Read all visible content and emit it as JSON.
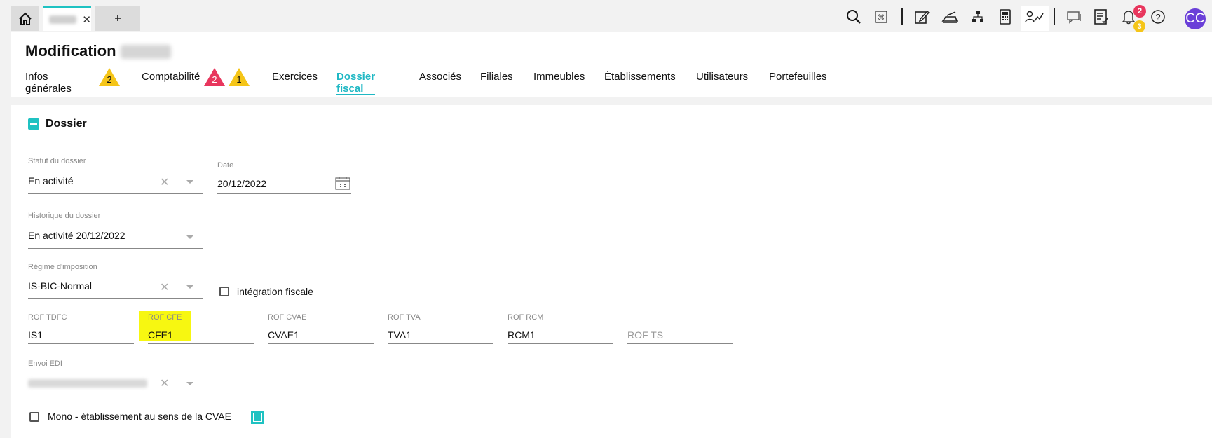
{
  "topbar": {
    "new_tab_label": "+",
    "notification_badges": [
      "2",
      "3"
    ],
    "avatar_initials": "CC",
    "icons": [
      "home-icon",
      "close-icon",
      "search-icon",
      "keyboard-icon",
      "edit-icon",
      "scanner-icon",
      "hierarchy-icon",
      "calculator-icon",
      "users-chart-icon",
      "chat-icon",
      "checklist-icon",
      "bell-icon",
      "help-icon"
    ]
  },
  "header": {
    "title": "Modification",
    "tabs": [
      {
        "label": "Infos générales",
        "badges": [
          {
            "type": "warning",
            "count": "2"
          }
        ]
      },
      {
        "label": "Comptabilité",
        "badges": [
          {
            "type": "error",
            "count": "2"
          },
          {
            "type": "warning",
            "count": "1"
          }
        ]
      },
      {
        "label": "Exercices"
      },
      {
        "label": "Dossier fiscal",
        "active": true
      },
      {
        "label": "Associés"
      },
      {
        "label": "Filiales"
      },
      {
        "label": "Immeubles"
      },
      {
        "label": "Établissements"
      },
      {
        "label": "Utilisateurs"
      },
      {
        "label": "Portefeuilles"
      }
    ]
  },
  "section": {
    "title": "Dossier",
    "statut": {
      "label": "Statut du dossier",
      "value": "En activité"
    },
    "date": {
      "label": "Date",
      "value": "20/12/2022"
    },
    "historique": {
      "label": "Historique du dossier",
      "value": "En activité 20/12/2022"
    },
    "regime": {
      "label": "Régime d'imposition",
      "value": "IS-BIC-Normal"
    },
    "integration": {
      "label": "intégration fiscale",
      "checked": false
    },
    "rof": [
      {
        "label": "ROF TDFC",
        "value": "IS1"
      },
      {
        "label": "ROF CFE",
        "value": "CFE1"
      },
      {
        "label": "ROF CVAE",
        "value": "CVAE1"
      },
      {
        "label": "ROF TVA",
        "value": "TVA1"
      },
      {
        "label": "ROF RCM",
        "value": "RCM1"
      },
      {
        "label": "",
        "placeholder": "ROF TS"
      }
    ],
    "envoi_edi": {
      "label": "Envoi EDI"
    },
    "mono": {
      "label": "Mono - établissement au sens de la CVAE",
      "checked": false
    }
  },
  "colors": {
    "accent": "#1fc2c2",
    "warning": "#f5c518",
    "error": "#e8365d",
    "highlight": "#f7f711",
    "avatar": "#6a3fd8"
  }
}
